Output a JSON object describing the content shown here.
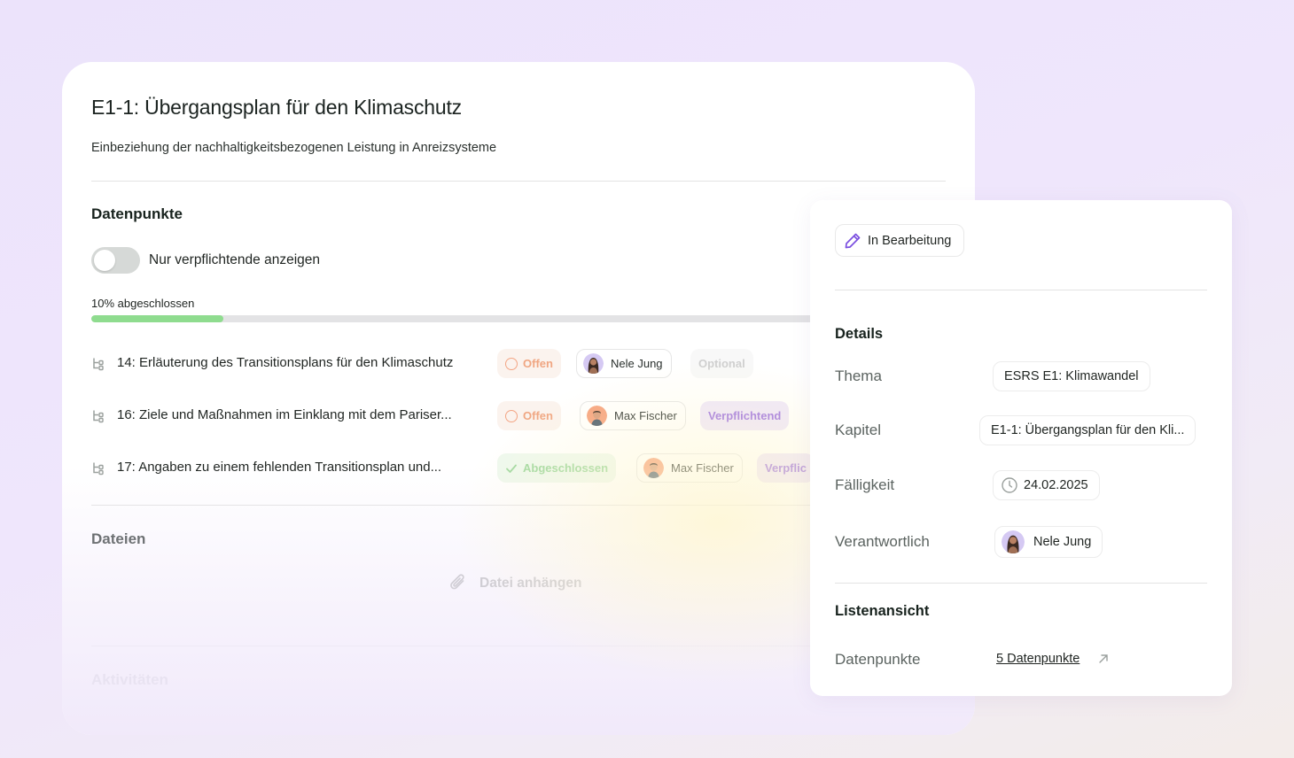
{
  "page": {
    "title": "E1-1: Übergangsplan für den Klimaschutz",
    "subtitle": "Einbeziehung der nachhaltigkeitsbezogenen Leistung in Anreizsysteme"
  },
  "datapoints": {
    "section_title": "Datenpunkte",
    "toggle_label": "Nur verpflichtende anzeigen",
    "toggle_on": false,
    "progress_label": "10% abgeschlossen",
    "progress_fraction": 0.155,
    "items": [
      {
        "icon": "subtree-icon",
        "title": "14: Erläuterung des Transitionsplans für den Klimaschutz",
        "status": "Offen",
        "user": "Nele Jung",
        "requirement": "Optional"
      },
      {
        "icon": "subtree-icon",
        "title": "16: Ziele und Maßnahmen im Einklang mit dem Pariser...",
        "status": "Offen",
        "user": "Max Fischer",
        "requirement": "Verpflichtend"
      },
      {
        "icon": "subtree-icon",
        "title": "17: Angaben zu einem fehlenden Transitionsplan und...",
        "status": "Abgeschlossen",
        "user": "Max Fischer",
        "requirement": "Verpflic"
      }
    ]
  },
  "files": {
    "section_title": "Dateien",
    "attach_label": "Datei anhängen",
    "attach_icon": "paperclip-icon"
  },
  "activities": {
    "section_title": "Aktivitäten"
  },
  "sidebar": {
    "status": {
      "icon": "pencil-icon",
      "label": "In Bearbeitung"
    },
    "details_title": "Details",
    "details": {
      "thema_label": "Thema",
      "thema_value": "ESRS E1: Klimawandel",
      "kapitel_label": "Kapitel",
      "kapitel_value": "E1-1: Übergangsplan für den Kli...",
      "faelligkeit_label": "Fälligkeit",
      "faelligkeit_value": "24.02.2025",
      "verantwortlich_label": "Verantwortlich",
      "verantwortlich_value": "Nele Jung"
    },
    "list_title": "Listenansicht",
    "list": {
      "label": "Datenpunkte",
      "link": "5 Datenpunkte",
      "link_icon": "arrow-up-right-icon"
    }
  },
  "colors": {
    "progress": "#8fdc8f",
    "status_open": "#f0a682",
    "status_done": "#9dd79d",
    "required": "#9b6fe0",
    "status_icon": "#7b4fe0"
  }
}
